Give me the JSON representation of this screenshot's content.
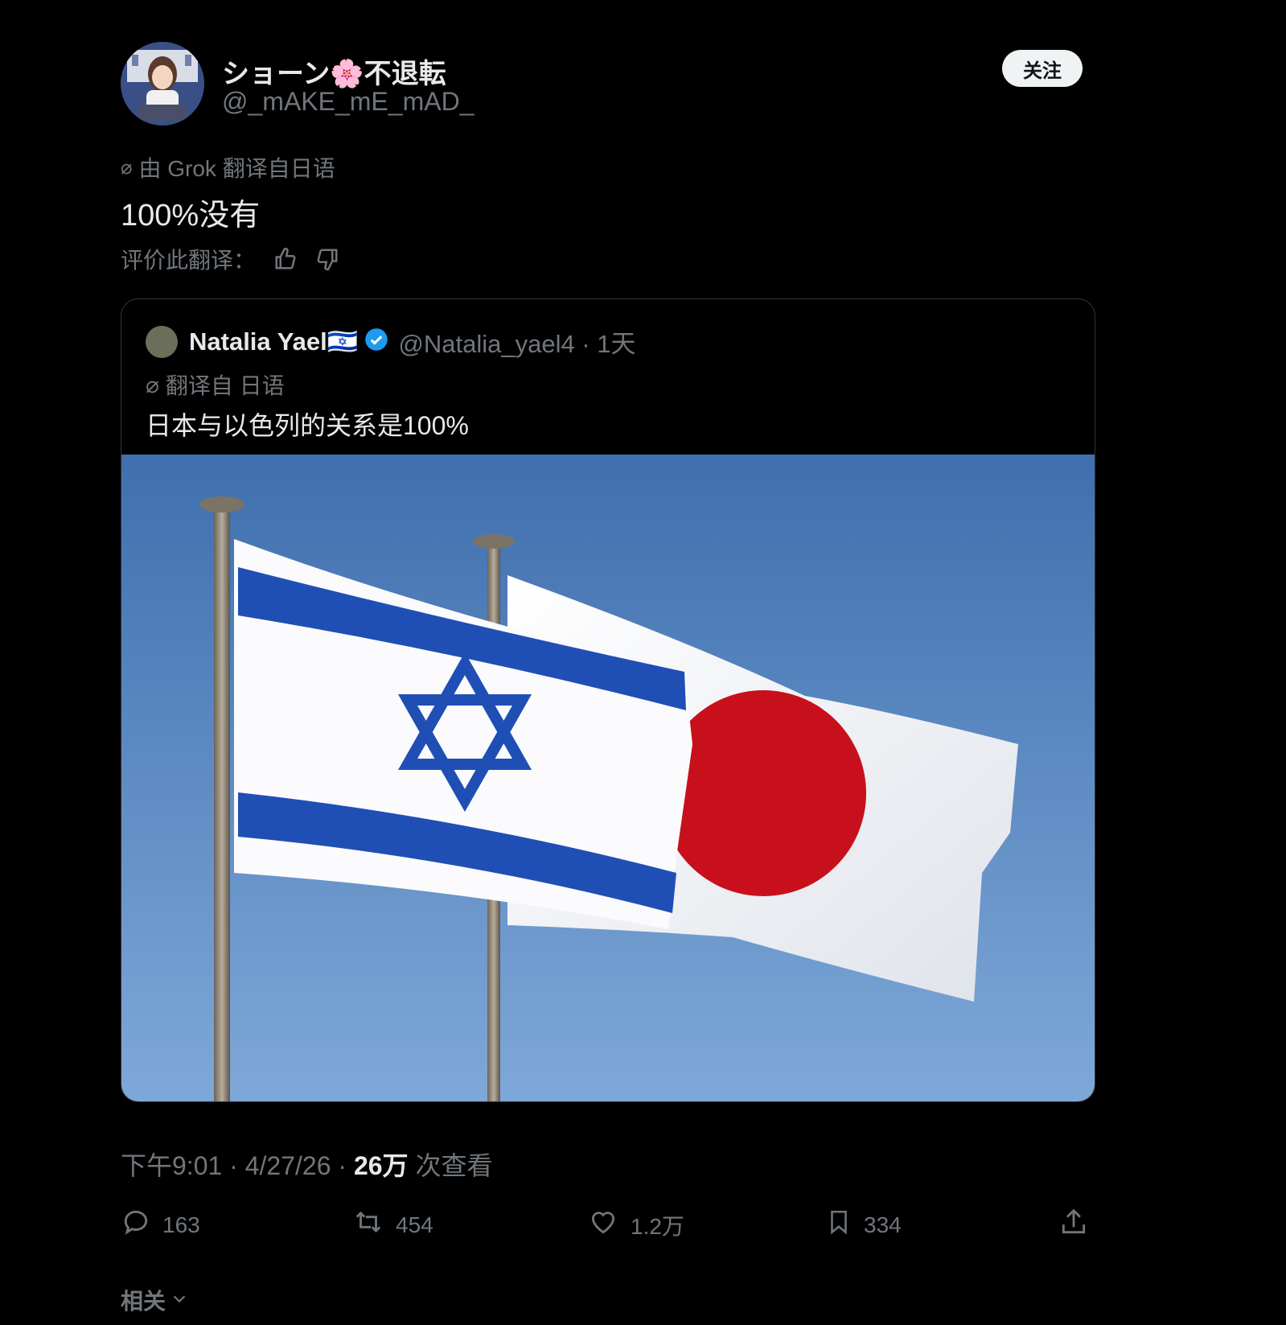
{
  "author": {
    "name": "ショーン🌸不退転",
    "handle": "@_mAKE_mE_mAD_",
    "follow_label": "关注"
  },
  "translation": {
    "label": "由 Grok 翻译自日语",
    "text": "100%没有",
    "rate_label": "评价此翻译："
  },
  "quoted": {
    "name": "Natalia Yael🇮🇱",
    "handle_time": "@Natalia_yael4 · 1天",
    "translated_from": "翻译自 日语",
    "text": "日本与以色列的关系是100%"
  },
  "meta": {
    "time": "下午9:01 · 4/27/26 · ",
    "views_count": "26万",
    "views_label": " 次查看"
  },
  "actions": {
    "replies": "163",
    "reposts": "454",
    "likes": "1.2万",
    "bookmarks": "334"
  },
  "related_label": "相关",
  "colors": {
    "background": "#000000",
    "text": "#e7e9ea",
    "secondary": "#71767b",
    "verified": "#1d9bf0",
    "sky": "#5a8ac8",
    "israel_blue": "#1f4fb5",
    "japan_red": "#c8101c"
  }
}
